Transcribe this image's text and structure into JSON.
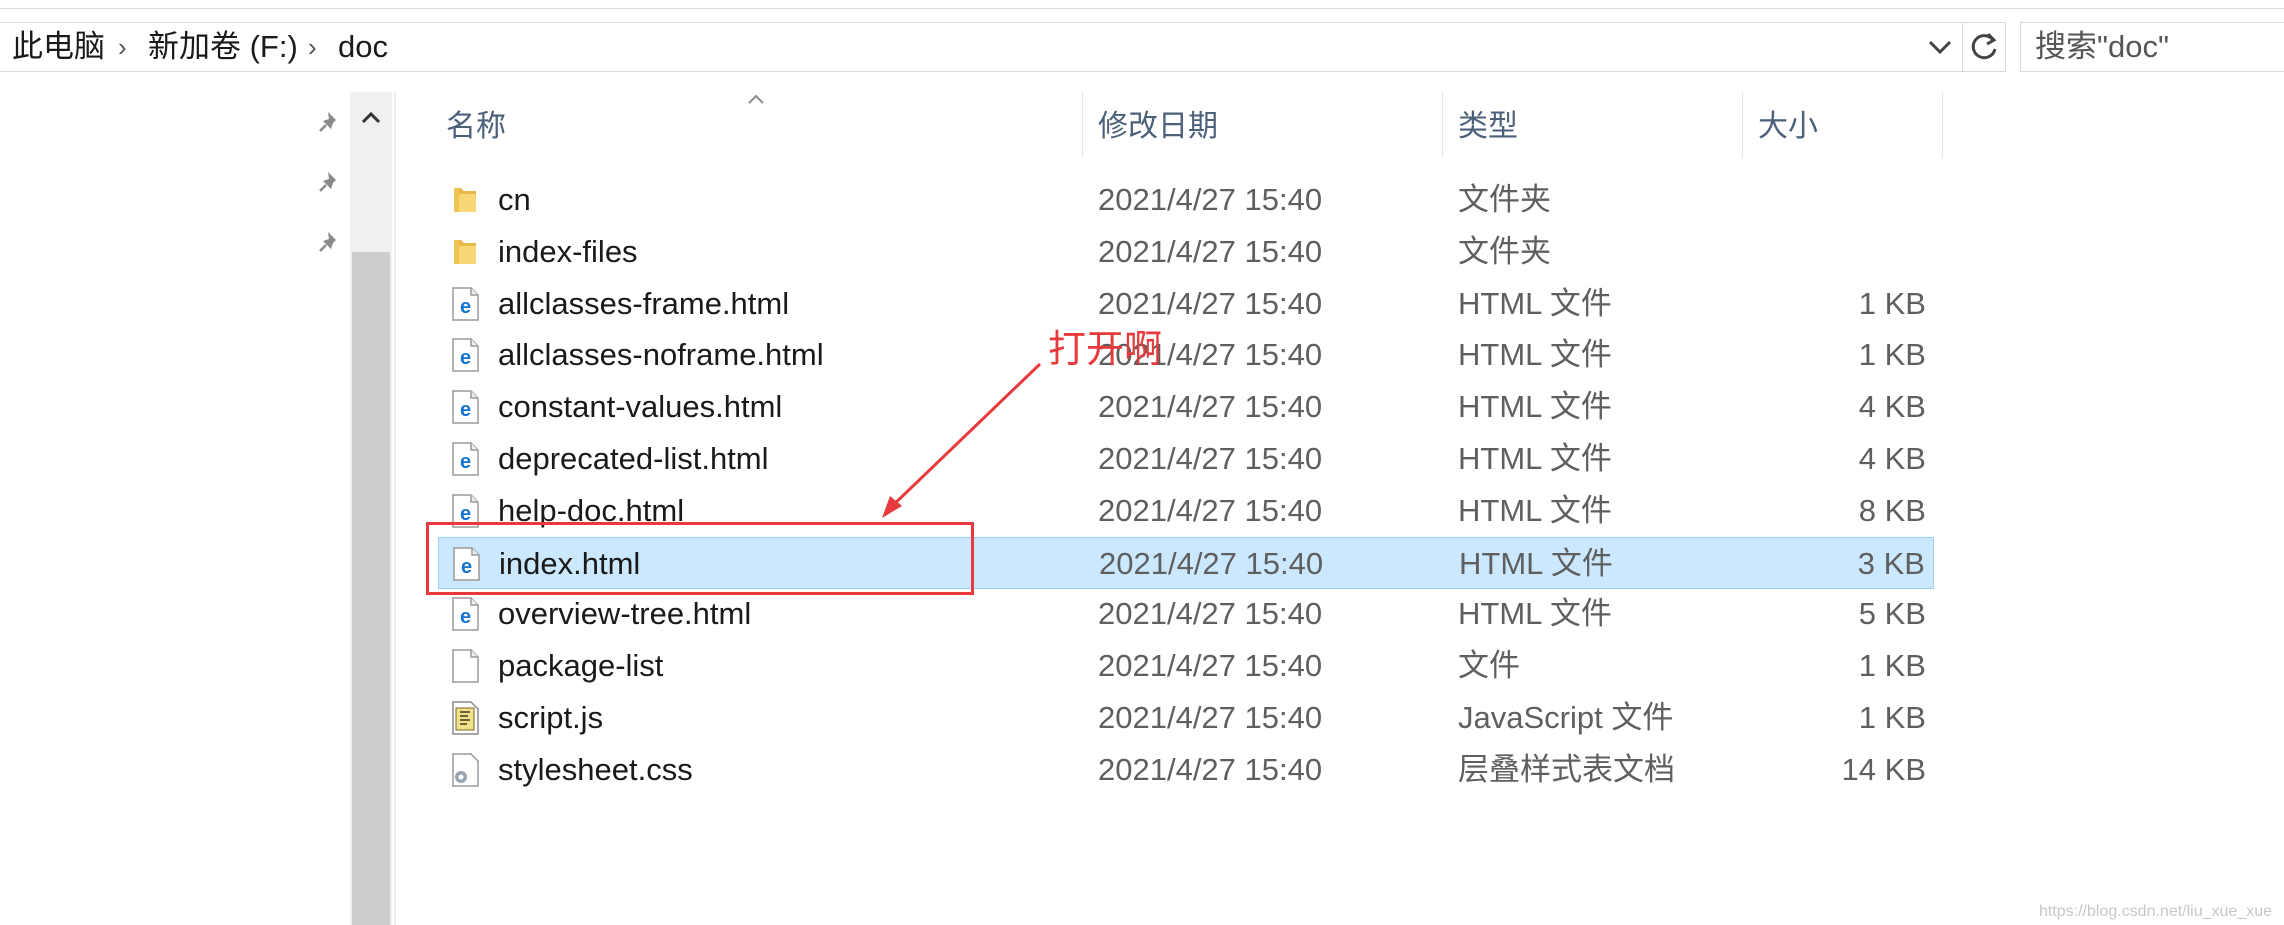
{
  "address_bar": {
    "breadcrumbs": [
      "此电脑",
      "新加卷 (F:)",
      "doc"
    ],
    "dropdown_icon": "chevron-down-icon",
    "refresh_icon": "refresh-icon"
  },
  "search": {
    "placeholder": "搜索\"doc\""
  },
  "nav_pane": {
    "pins": [
      "pin-icon",
      "pin-icon",
      "pin-icon"
    ]
  },
  "columns": {
    "name": "名称",
    "date": "修改日期",
    "type": "类型",
    "size": "大小"
  },
  "files": [
    {
      "name": "cn",
      "date": "2021/4/27 15:40",
      "type": "文件夹",
      "size": "",
      "icon": "folder-icon"
    },
    {
      "name": "index-files",
      "date": "2021/4/27 15:40",
      "type": "文件夹",
      "size": "",
      "icon": "folder-icon"
    },
    {
      "name": "allclasses-frame.html",
      "date": "2021/4/27 15:40",
      "type": "HTML 文件",
      "size": "1 KB",
      "icon": "edge-html-icon"
    },
    {
      "name": "allclasses-noframe.html",
      "date": "2021/4/27 15:40",
      "type": "HTML 文件",
      "size": "1 KB",
      "icon": "edge-html-icon"
    },
    {
      "name": "constant-values.html",
      "date": "2021/4/27 15:40",
      "type": "HTML 文件",
      "size": "4 KB",
      "icon": "edge-html-icon"
    },
    {
      "name": "deprecated-list.html",
      "date": "2021/4/27 15:40",
      "type": "HTML 文件",
      "size": "4 KB",
      "icon": "edge-html-icon"
    },
    {
      "name": "help-doc.html",
      "date": "2021/4/27 15:40",
      "type": "HTML 文件",
      "size": "8 KB",
      "icon": "edge-html-icon"
    },
    {
      "name": "index.html",
      "date": "2021/4/27 15:40",
      "type": "HTML 文件",
      "size": "3 KB",
      "icon": "edge-html-icon",
      "selected": true
    },
    {
      "name": "overview-tree.html",
      "date": "2021/4/27 15:40",
      "type": "HTML 文件",
      "size": "5 KB",
      "icon": "edge-html-icon"
    },
    {
      "name": "package-list",
      "date": "2021/4/27 15:40",
      "type": "文件",
      "size": "1 KB",
      "icon": "blank-file-icon"
    },
    {
      "name": "script.js",
      "date": "2021/4/27 15:40",
      "type": "JavaScript 文件",
      "size": "1 KB",
      "icon": "script-file-icon"
    },
    {
      "name": "stylesheet.css",
      "date": "2021/4/27 15:40",
      "type": "层叠样式表文档",
      "size": "14 KB",
      "icon": "css-file-icon"
    }
  ],
  "annotation": {
    "text": "打开啊",
    "color": "#e8393d"
  },
  "watermark": "https://blog.csdn.net/liu_xue_xue",
  "colors": {
    "selection_bg": "#cce8ff",
    "selection_border": "#99d1ff",
    "header_text": "#4c607a"
  }
}
